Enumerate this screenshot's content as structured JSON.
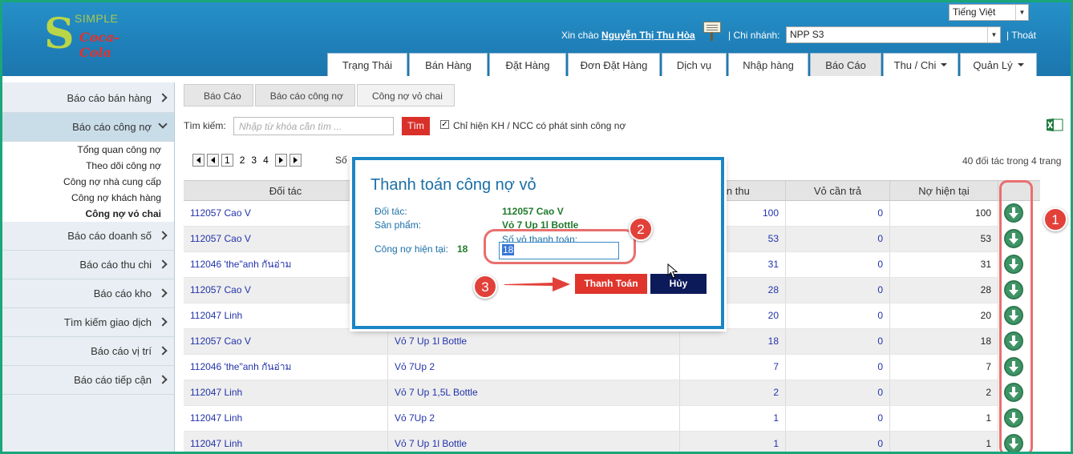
{
  "header": {
    "logo_simple": "SIMPLE",
    "logo_brand": "Coca-Cola",
    "language": "Tiếng Việt",
    "greeting": "Xin chào",
    "user_name": "Nguyễn Thị Thu Hòa",
    "branch_label": "| Chi nhánh:",
    "branch_value": "NPP S3",
    "logout": "| Thoát",
    "nav": [
      {
        "label": "Trạng Thái"
      },
      {
        "label": "Bán Hàng"
      },
      {
        "label": "Đặt Hàng"
      },
      {
        "label": "Đơn Đặt Hàng"
      },
      {
        "label": "Dịch vụ"
      },
      {
        "label": "Nhập hàng"
      },
      {
        "label": "Báo Cáo"
      },
      {
        "label": "Thu / Chi"
      },
      {
        "label": "Quản Lý"
      }
    ]
  },
  "sidebar": {
    "items": [
      {
        "label": "Báo cáo bán hàng"
      },
      {
        "label": "Báo cáo công nợ"
      },
      {
        "label": "Báo cáo doanh số"
      },
      {
        "label": "Báo cáo thu chi"
      },
      {
        "label": "Báo cáo kho"
      },
      {
        "label": "Tìm kiếm giao dịch"
      },
      {
        "label": "Báo cáo vị trí"
      },
      {
        "label": "Báo cáo tiếp cận"
      }
    ],
    "sub_items": [
      {
        "label": "Tổng quan công nợ"
      },
      {
        "label": "Theo dõi công nợ"
      },
      {
        "label": "Công nợ nhà cung cấp"
      },
      {
        "label": "Công nợ khách hàng"
      },
      {
        "label": "Công nợ vỏ chai"
      }
    ]
  },
  "breadcrumb": [
    "Báo Cáo",
    "Báo cáo công nợ",
    "Công nợ vỏ chai"
  ],
  "search": {
    "label": "Tìm kiếm:",
    "placeholder": "Nhập từ khóa cần tìm ...",
    "button": "Tìm",
    "checkbox_label": "Chỉ hiện KH / NCC có phát sinh công nợ",
    "checked_mark": "✓"
  },
  "pager": {
    "pages": [
      "1",
      "2",
      "3",
      "4"
    ],
    "so_label": "Số d",
    "total": "40 đối tác trong 4 trang"
  },
  "table": {
    "headers": [
      "Đối tác",
      "",
      "cần thu",
      "Vỏ cần trả",
      "Nợ hiện tại"
    ],
    "rows": [
      {
        "partner": "112057 Cao V",
        "product": "",
        "thu": "100",
        "tra": "0",
        "no": "100"
      },
      {
        "partner": "112057 Cao V",
        "product": "",
        "thu": "53",
        "tra": "0",
        "no": "53"
      },
      {
        "partner": "112046 'the\"anh กันอ่าม",
        "product": "",
        "thu": "31",
        "tra": "0",
        "no": "31"
      },
      {
        "partner": "112057 Cao V",
        "product": "",
        "thu": "28",
        "tra": "0",
        "no": "28"
      },
      {
        "partner": "112047 Linh",
        "product": "",
        "thu": "20",
        "tra": "0",
        "no": "20"
      },
      {
        "partner": "112057 Cao V",
        "product": "Vỏ 7 Up 1l Bottle",
        "thu": "18",
        "tra": "0",
        "no": "18"
      },
      {
        "partner": "112046 'the\"anh กันอ่าม",
        "product": "Vỏ 7Up 2",
        "thu": "7",
        "tra": "0",
        "no": "7"
      },
      {
        "partner": "112047 Linh",
        "product": "Vỏ 7 Up 1,5L Bottle",
        "thu": "2",
        "tra": "0",
        "no": "2"
      },
      {
        "partner": "112047 Linh",
        "product": "Vỏ 7Up 2",
        "thu": "1",
        "tra": "0",
        "no": "1"
      },
      {
        "partner": "112047 Linh",
        "product": "Vỏ 7 Up 1l Bottle",
        "thu": "1",
        "tra": "0",
        "no": "1"
      }
    ]
  },
  "modal": {
    "title": "Thanh toán công nợ vỏ",
    "partner_label": "Đối tác:",
    "partner_value": "112057 Cao V",
    "product_label": "Sản phẩm:",
    "product_value": "Vỏ 7 Up 1l Bottle",
    "current_label": "Công nợ hiện tại:",
    "current_value": "18",
    "qty_label": "Số vỏ thanh toán:",
    "qty_value": "18",
    "pay_button": "Thanh Toán",
    "cancel_button": "Hủy"
  },
  "annotations": {
    "badge1": "1",
    "badge2": "2",
    "badge3": "3"
  },
  "colors": {
    "accent": "#1b86c4",
    "header": "#2690c8",
    "pay": "#e0352c",
    "cancel": "#0c1a5a",
    "annotation": "#e2413a"
  }
}
